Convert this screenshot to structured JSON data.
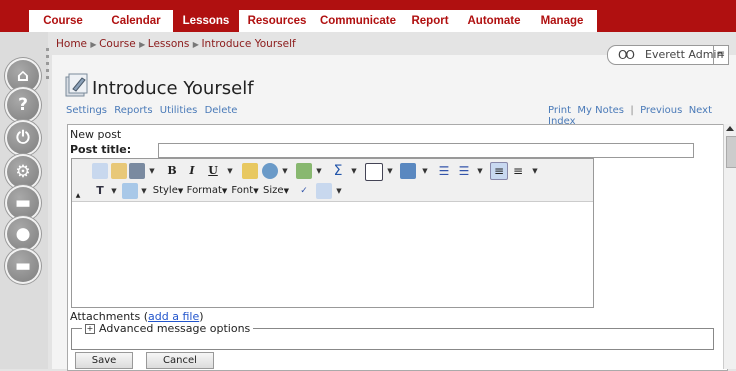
{
  "nav": {
    "items": [
      "Course",
      "Calendar",
      "Lessons",
      "Resources",
      "Communicate",
      "Report",
      "Automate",
      "Manage"
    ],
    "active": "Lessons"
  },
  "breadcrumb": {
    "items": [
      "Home",
      "Course",
      "Lessons",
      "Introduce Yourself"
    ]
  },
  "user": {
    "name": "Everett Admin"
  },
  "page": {
    "title": "Introduce Yourself"
  },
  "page_tools_left": [
    "Settings",
    "Reports",
    "Utilities",
    "Delete"
  ],
  "page_tools_right": {
    "print": "Print",
    "notes": "My Notes",
    "sep": "|",
    "previous": "Previous",
    "next": "Next",
    "index": "Index"
  },
  "form": {
    "heading": "New post",
    "post_title_label": "Post title:",
    "post_title_value": "",
    "attachments_label": "Attachments (",
    "add_file": "add a file",
    "attachments_close": ")",
    "advanced_label": "Advanced message options",
    "save_label": "Save",
    "cancel_label": "Cancel"
  },
  "editor": {
    "style_label": "Style",
    "format_label": "Format",
    "font_label": "Font",
    "size_label": "Size",
    "b": "B",
    "i": "I",
    "u": "U",
    "sigma": "Σ"
  },
  "colors": {
    "brand": "#b01010",
    "link": "#4a7ab8",
    "breadcrumb": "#8b1a1a"
  }
}
